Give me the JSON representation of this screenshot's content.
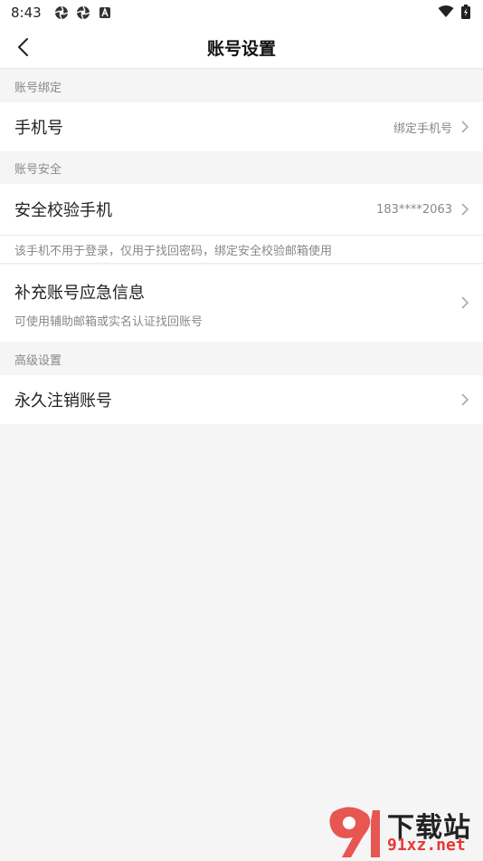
{
  "status_bar": {
    "time": "8:43"
  },
  "header": {
    "title": "账号设置"
  },
  "sections": {
    "binding": "账号绑定",
    "security": "账号安全",
    "advanced": "高级设置"
  },
  "rows": {
    "phone": {
      "label": "手机号",
      "value": "绑定手机号"
    },
    "security_phone": {
      "label": "安全校验手机",
      "value": "183****2063"
    },
    "security_note": "该手机不用于登录，仅用于找回密码，绑定安全校验邮箱使用",
    "emergency": {
      "label": "补充账号应急信息",
      "sub": "可使用辅助邮箱或实名认证找回账号"
    },
    "delete": {
      "label": "永久注销账号"
    }
  },
  "watermark": {
    "title": "下载站",
    "domain": "91xz.net"
  }
}
